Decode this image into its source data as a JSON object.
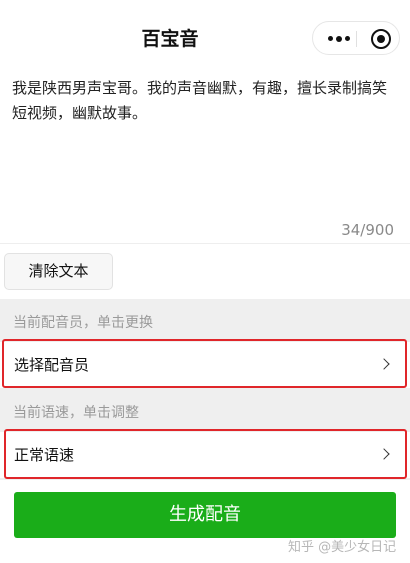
{
  "header": {
    "title": "百宝音"
  },
  "editor": {
    "text": "我是陕西男声宝哥。我的声音幽默，有趣，擅长录制搞笑短视频，幽默故事。",
    "counter": "34/900"
  },
  "actions": {
    "clear_label": "清除文本",
    "generate_label": "生成配音"
  },
  "voice": {
    "hint": "当前配音员，单击更换",
    "label": "选择配音员"
  },
  "speed": {
    "hint": "当前语速，单击调整",
    "label": "正常语速"
  },
  "watermark": "知乎 @美少女日记",
  "colors": {
    "primary_green": "#1aad19",
    "highlight_red": "#e0262a",
    "section_gray": "#efefef"
  }
}
